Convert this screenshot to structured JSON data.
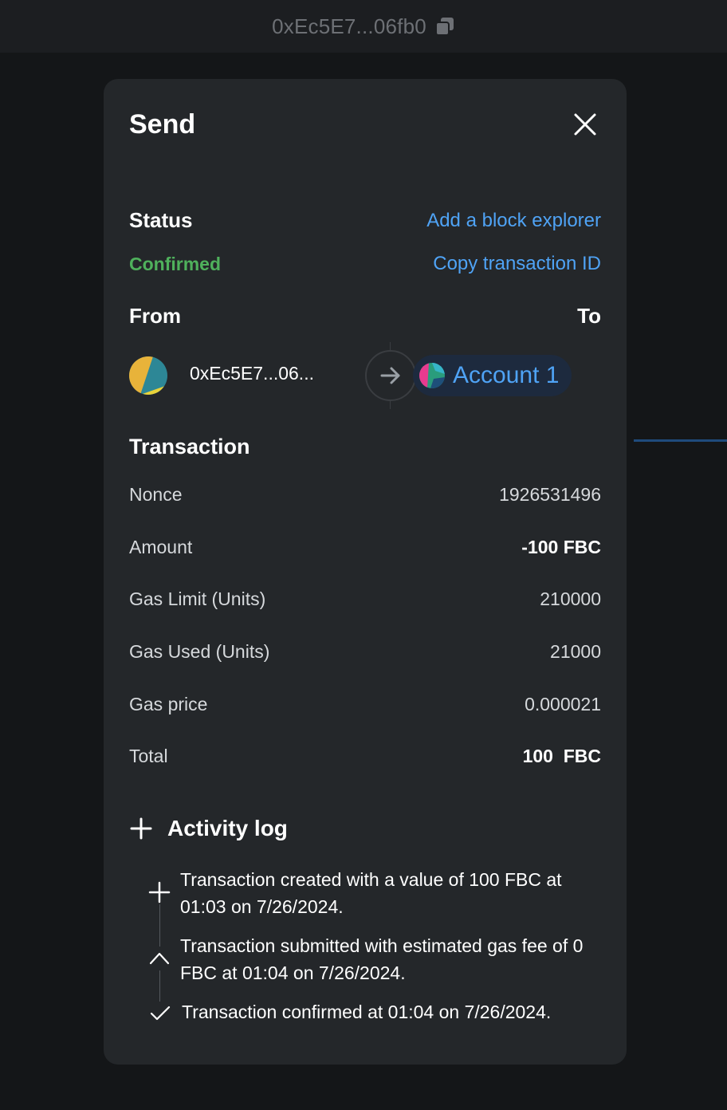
{
  "topbar": {
    "address": "0xEc5E7...06fb0",
    "copy_icon": "copy-icon"
  },
  "modal": {
    "title": "Send",
    "close_icon": "close-icon",
    "status_label": "Status",
    "status_value": "Confirmed",
    "add_explorer_link": "Add a block explorer",
    "copy_tx_link": "Copy transaction ID",
    "from_label": "From",
    "to_label": "To",
    "from_address": "0xEc5E7...06...",
    "to_account": "Account 1",
    "transaction_title": "Transaction",
    "details": [
      {
        "label": "Nonce",
        "value": "1926531496"
      },
      {
        "label": "Amount",
        "value": "-100 FBC"
      },
      {
        "label": "Gas Limit (Units)",
        "value": "210000"
      },
      {
        "label": "Gas Used (Units)",
        "value": "21000"
      },
      {
        "label": "Gas price",
        "value": "0.000021"
      },
      {
        "label": "Total",
        "value": "100  FBC"
      }
    ],
    "activity_log_title": "Activity log",
    "activity_log": [
      {
        "icon": "plus-icon",
        "text": "Transaction created with a value of 100 FBC at 01:03 on 7/26/2024."
      },
      {
        "icon": "caret-up-icon",
        "text": "Transaction submitted with estimated gas fee of 0 FBC at 01:04 on 7/26/2024."
      },
      {
        "icon": "check-icon",
        "text": "Transaction confirmed at 01:04 on 7/26/2024."
      }
    ]
  },
  "colors": {
    "background": "#141618",
    "modal": "#24272a",
    "link": "#4fa3f5",
    "confirmed": "#4fb15c"
  }
}
